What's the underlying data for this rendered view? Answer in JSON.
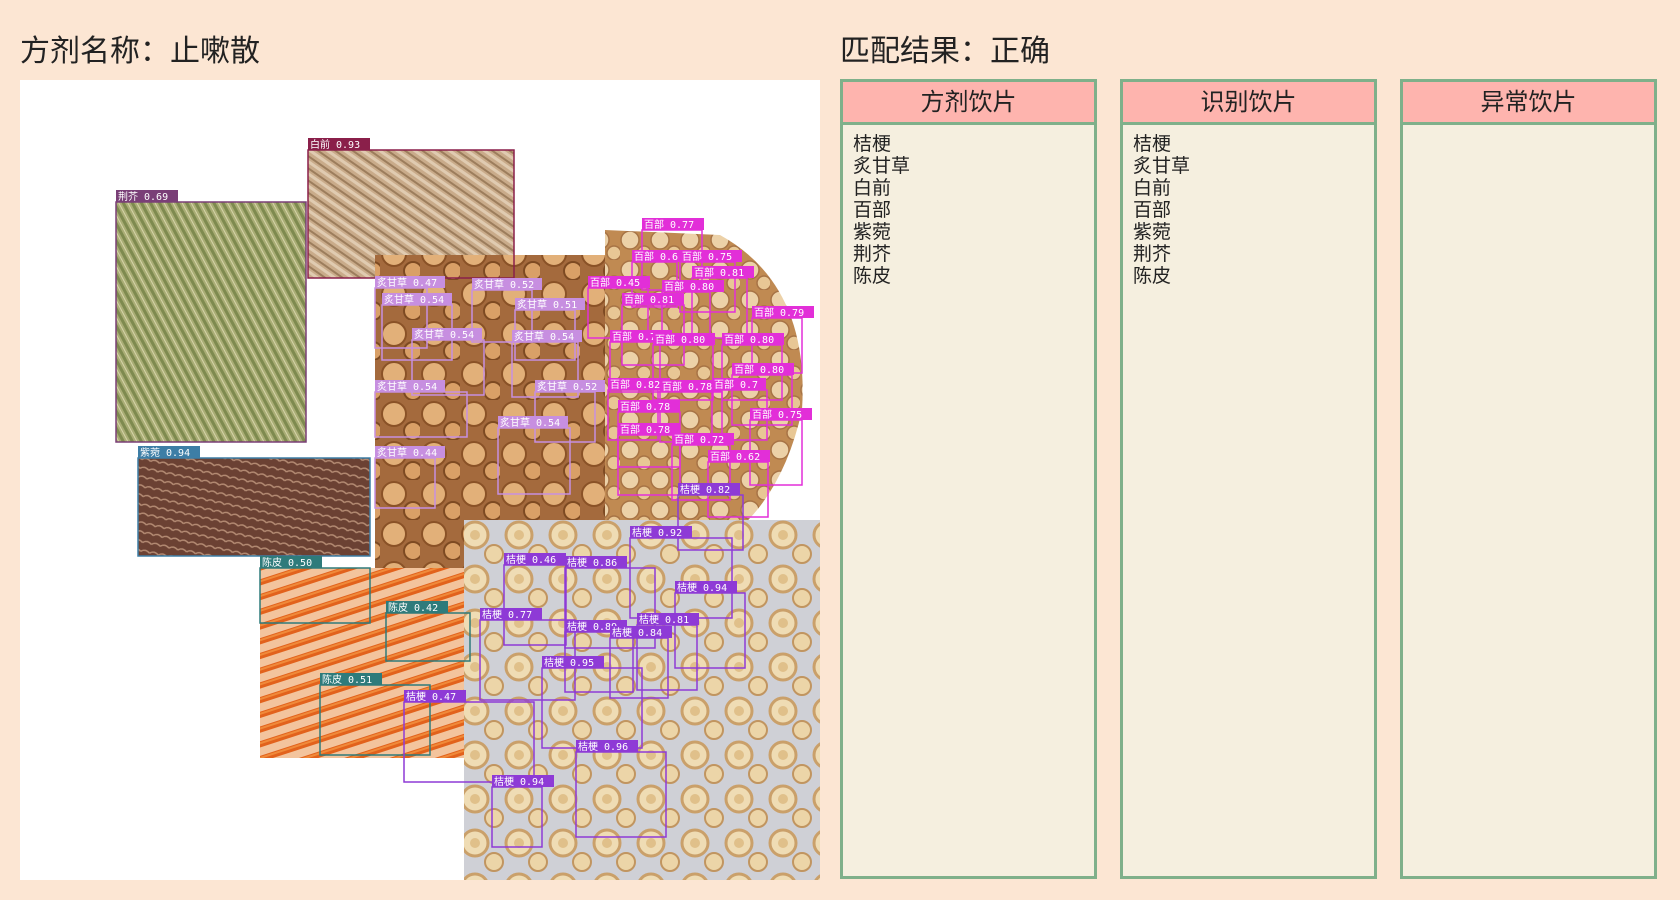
{
  "header": {
    "formula": "方剂名称：止嗽散",
    "result": "匹配结果：正确"
  },
  "panels": [
    {
      "title": "方剂饮片",
      "items": [
        "桔梗",
        "炙甘草",
        "白前",
        "百部",
        "紫菀",
        "荆芥",
        "陈皮"
      ]
    },
    {
      "title": "识别饮片",
      "items": [
        "桔梗",
        "炙甘草",
        "白前",
        "百部",
        "紫菀",
        "荆芥",
        "陈皮"
      ]
    },
    {
      "title": "异常饮片",
      "items": []
    }
  ],
  "colors": {
    "background": "#fce6d3",
    "panel_header": "#feb4ae",
    "panel_border": "#7fb08a",
    "panel_body": "#f5efdf",
    "herb_jingjie": "#7a3f77",
    "herb_baiqian": "#8a1f4a",
    "herb_zhigancao": "#c78fe0",
    "herb_baibu": "#e22fd8",
    "herb_ziwan": "#3d7ea6",
    "herb_chenpi": "#2e7b7b",
    "herb_jiegeng": "#8e3ad6"
  },
  "detections": [
    {
      "label": "荆芥 0.69",
      "herb": "jingjie"
    },
    {
      "label": "白前 0.93",
      "herb": "baiqian"
    },
    {
      "label": "紫菀 0.94",
      "herb": "ziwan"
    },
    {
      "label": "炙甘草 0.47",
      "herb": "zhigancao"
    },
    {
      "label": "炙甘草 0.52",
      "herb": "zhigancao"
    },
    {
      "label": "炙甘草 0.54",
      "herb": "zhigancao"
    },
    {
      "label": "炙甘草 0.51",
      "herb": "zhigancao"
    },
    {
      "label": "炙甘草 0.54",
      "herb": "zhigancao"
    },
    {
      "label": "炙甘草 0.54",
      "herb": "zhigancao"
    },
    {
      "label": "炙甘草 0.54",
      "herb": "zhigancao"
    },
    {
      "label": "炙甘草 0.52",
      "herb": "zhigancao"
    },
    {
      "label": "炙甘草 0.54",
      "herb": "zhigancao"
    },
    {
      "label": "炙甘草 0.44",
      "herb": "zhigancao"
    },
    {
      "label": "百部 0.77",
      "herb": "baibu"
    },
    {
      "label": "百部 0.6",
      "herb": "baibu"
    },
    {
      "label": "百部 0.75",
      "herb": "baibu"
    },
    {
      "label": "百部 0.81",
      "herb": "baibu"
    },
    {
      "label": "百部 0.45",
      "herb": "baibu"
    },
    {
      "label": "百部 0.80",
      "herb": "baibu"
    },
    {
      "label": "百部 0.81",
      "herb": "baibu"
    },
    {
      "label": "百部 0.79",
      "herb": "baibu"
    },
    {
      "label": "百部 0.75",
      "herb": "baibu"
    },
    {
      "label": "百部 0.80",
      "herb": "baibu"
    },
    {
      "label": "百部 0.80",
      "herb": "baibu"
    },
    {
      "label": "百部 0.80",
      "herb": "baibu"
    },
    {
      "label": "百部 0.82",
      "herb": "baibu"
    },
    {
      "label": "百部 0.78",
      "herb": "baibu"
    },
    {
      "label": "百部 0.7",
      "herb": "baibu"
    },
    {
      "label": "百部 0.78",
      "herb": "baibu"
    },
    {
      "label": "百部 0.75",
      "herb": "baibu"
    },
    {
      "label": "百部 0.78",
      "herb": "baibu"
    },
    {
      "label": "百部 0.72",
      "herb": "baibu"
    },
    {
      "label": "百部 0.62",
      "herb": "baibu"
    },
    {
      "label": "陈皮 0.50",
      "herb": "chenpi"
    },
    {
      "label": "陈皮 0.42",
      "herb": "chenpi"
    },
    {
      "label": "陈皮 0.51",
      "herb": "chenpi"
    },
    {
      "label": "桔梗 0.82",
      "herb": "jiegeng"
    },
    {
      "label": "桔梗 0.92",
      "herb": "jiegeng"
    },
    {
      "label": "桔梗 0.46",
      "herb": "jiegeng"
    },
    {
      "label": "桔梗 0.86",
      "herb": "jiegeng"
    },
    {
      "label": "桔梗 0.94",
      "herb": "jiegeng"
    },
    {
      "label": "桔梗 0.77",
      "herb": "jiegeng"
    },
    {
      "label": "桔梗 0.81",
      "herb": "jiegeng"
    },
    {
      "label": "桔梗 0.89",
      "herb": "jiegeng"
    },
    {
      "label": "桔梗 0.84",
      "herb": "jiegeng"
    },
    {
      "label": "桔梗 0.95",
      "herb": "jiegeng"
    },
    {
      "label": "桔梗 0.47",
      "herb": "jiegeng"
    },
    {
      "label": "桔梗 0.96",
      "herb": "jiegeng"
    },
    {
      "label": "桔梗 0.94",
      "herb": "jiegeng"
    }
  ]
}
